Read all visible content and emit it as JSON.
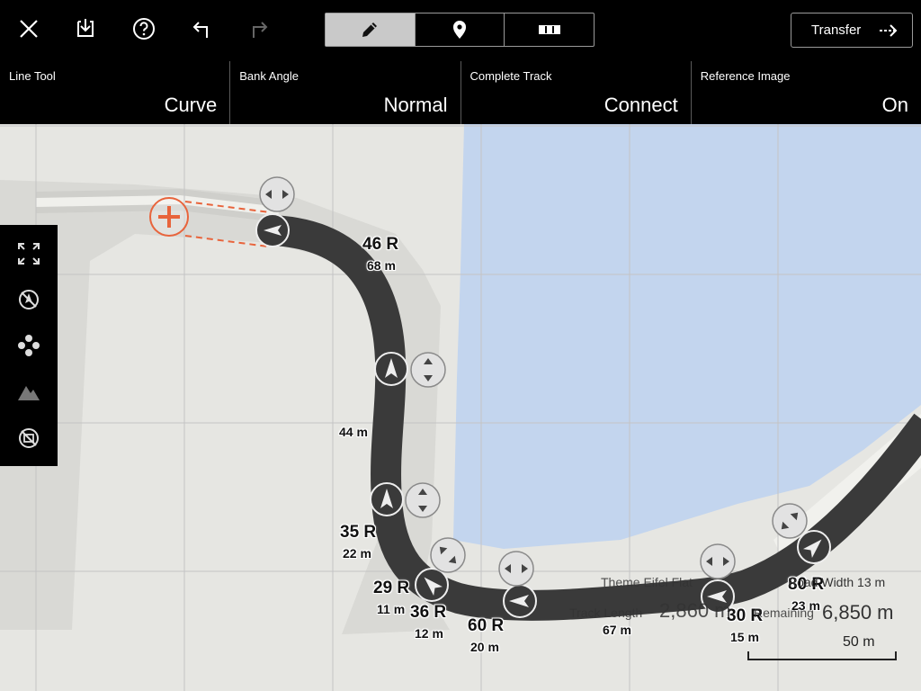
{
  "toolbar": {
    "icons": [
      "close-icon",
      "save-icon",
      "help-icon",
      "undo-icon",
      "redo-icon"
    ],
    "modes": [
      {
        "name": "pencil-icon",
        "active": true
      },
      {
        "name": "pin-icon",
        "active": false
      },
      {
        "name": "segments-icon",
        "active": false
      }
    ],
    "transfer_label": "Transfer"
  },
  "settings": [
    {
      "label": "Line Tool",
      "value": "Curve"
    },
    {
      "label": "Bank Angle",
      "value": "Normal"
    },
    {
      "label": "Complete Track",
      "value": "Connect"
    },
    {
      "label": "Reference Image",
      "value": "On"
    }
  ],
  "sidebar_icons": [
    "fullscreen-icon",
    "no-compass-icon",
    "move-points-icon",
    "elevation-icon",
    "no-image-icon"
  ],
  "track_labels": {
    "r1": "46 R",
    "l1": "68 m",
    "l2": "44 m",
    "r3": "35 R",
    "l3": "22 m",
    "r4": "29 R",
    "l4": "11 m",
    "r5": "36 R",
    "l5": "12 m",
    "r6": "60 R",
    "l6": "20 m",
    "l7": "67 m",
    "r8": "30 R",
    "l8": "15 m",
    "r9": "80 R",
    "l9": "23 m"
  },
  "info": {
    "theme": "Theme Eifel Flat",
    "road_width": "Road Width 13 m",
    "track_length_label": "Track Length",
    "track_length_value": "2,860 m",
    "remaining_label": "Remaining",
    "remaining_value": "6,850 m",
    "scale": "50 m"
  },
  "colors": {
    "accent": "#e8643c",
    "water": "#c3d5ee",
    "track": "#3a3a3a"
  }
}
